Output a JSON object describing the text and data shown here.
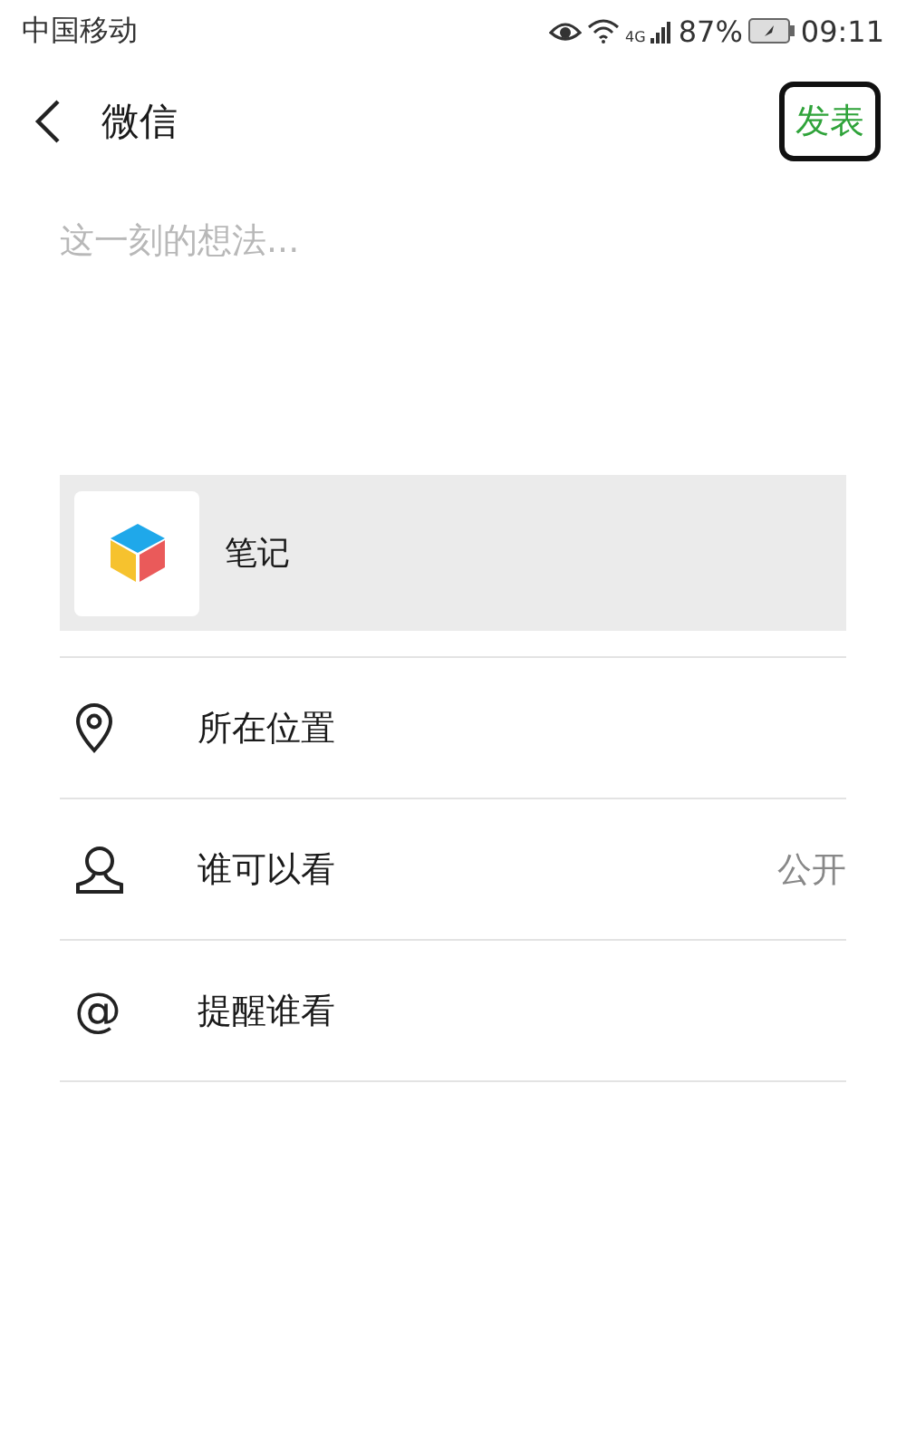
{
  "status_bar": {
    "carrier": "中国移动",
    "network": "4G",
    "battery": "87%",
    "time": "09:11"
  },
  "header": {
    "back": "微信",
    "publish": "发表"
  },
  "composer": {
    "placeholder": "这一刻的想法..."
  },
  "attachment": {
    "title": "笔记"
  },
  "options": [
    {
      "kind": "location",
      "label": "所在位置"
    },
    {
      "kind": "visibility",
      "label": "谁可以看",
      "value": "公开"
    },
    {
      "kind": "mention",
      "icon": "@",
      "label": "提醒谁看"
    }
  ]
}
